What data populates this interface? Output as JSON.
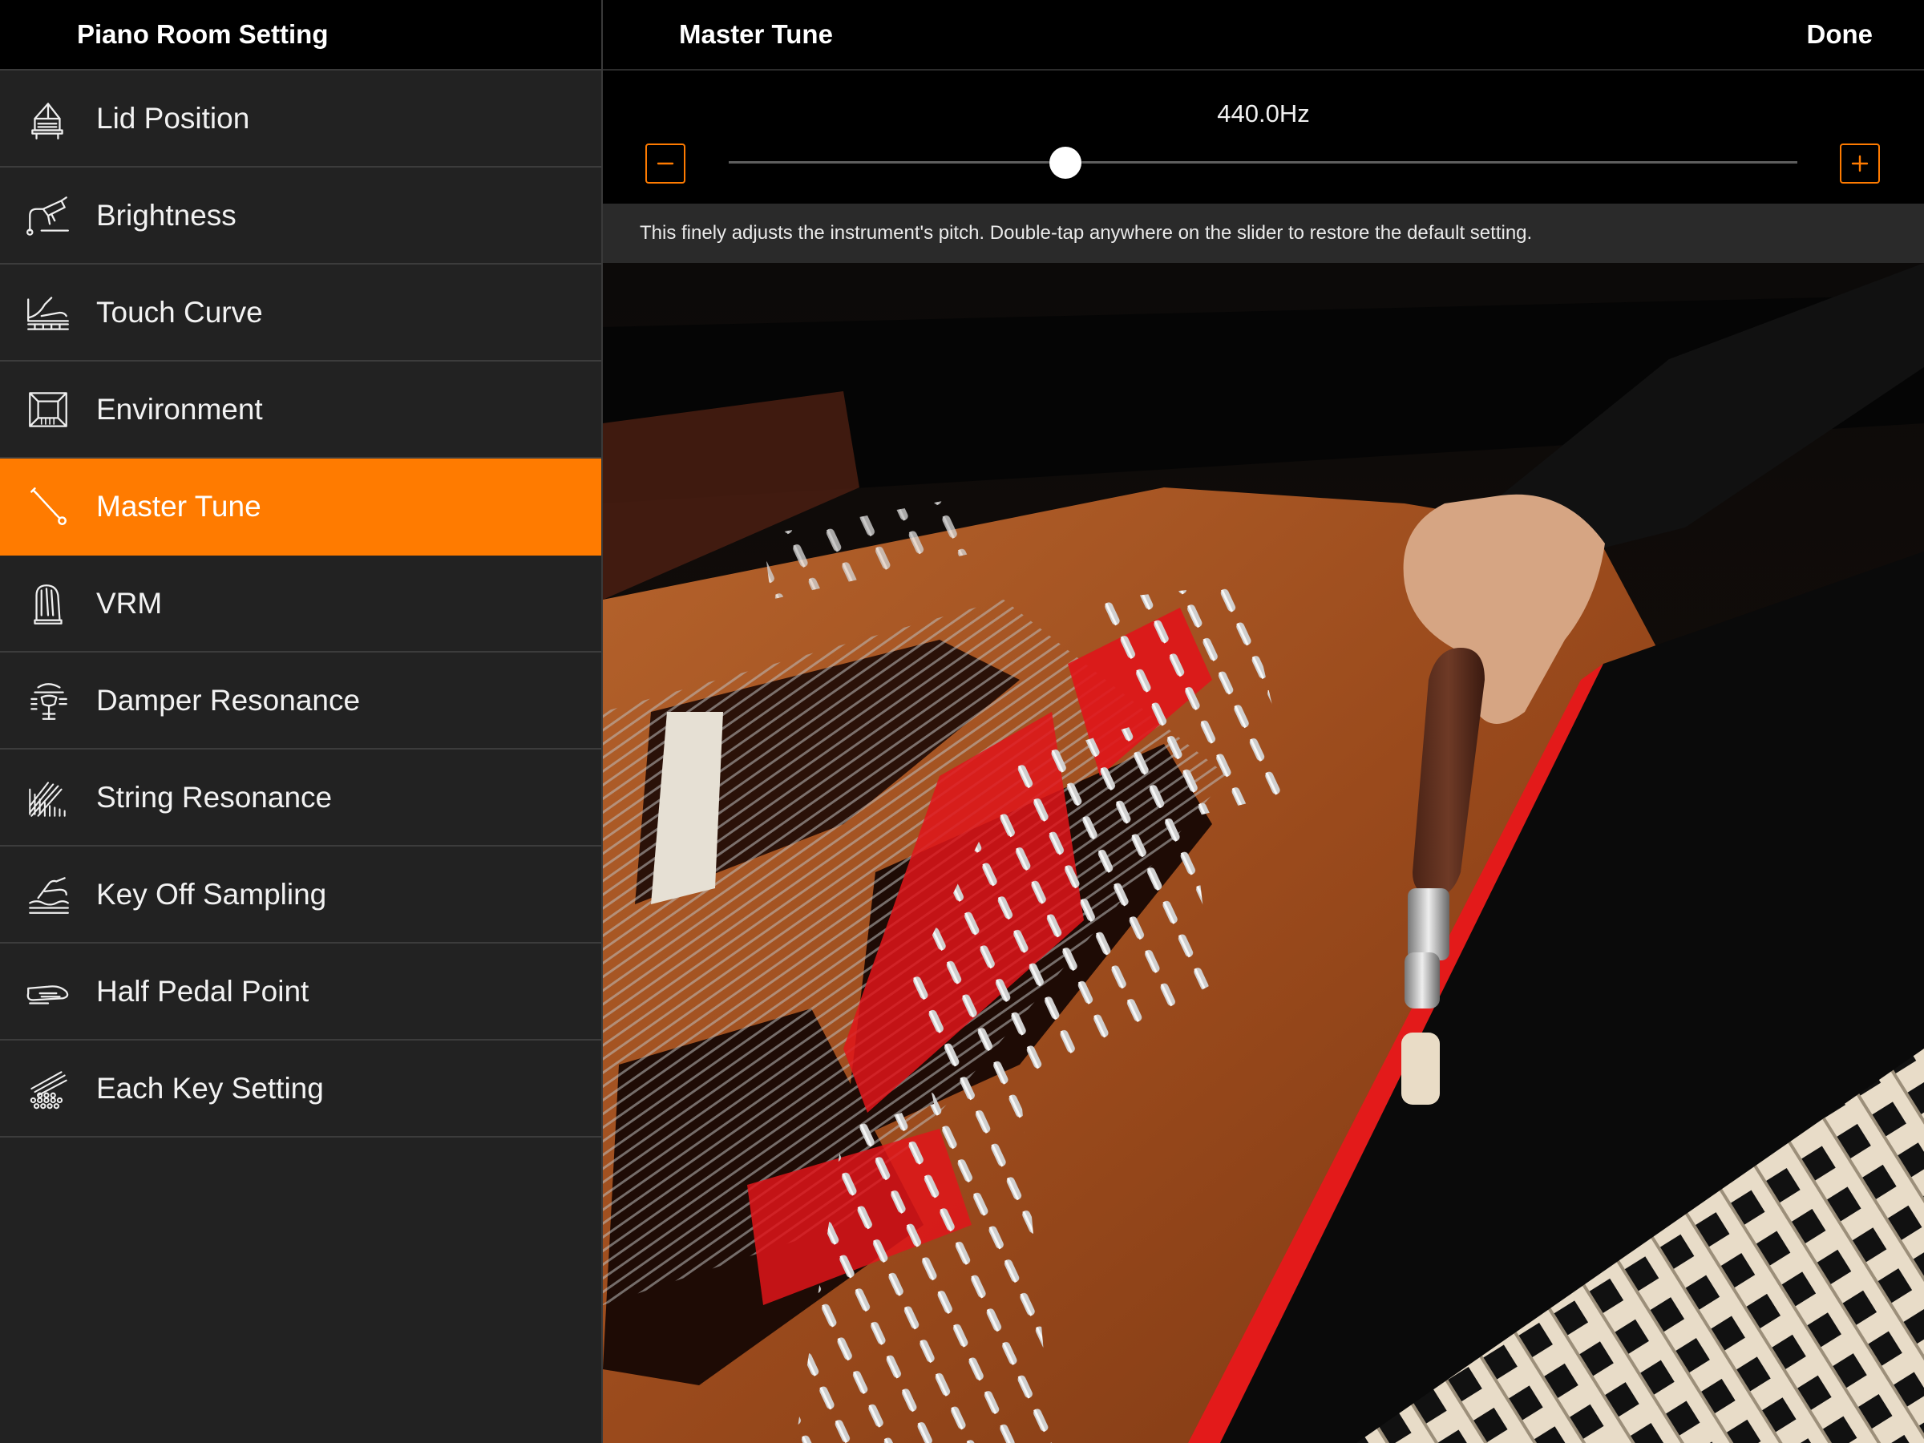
{
  "left_panel": {
    "title": "Piano Room Setting",
    "items": [
      {
        "label": "Lid Position",
        "icon": "grand-piano-lid-icon",
        "active": false
      },
      {
        "label": "Brightness",
        "icon": "brightness-lamp-icon",
        "active": false
      },
      {
        "label": "Touch Curve",
        "icon": "touch-curve-hand-icon",
        "active": false
      },
      {
        "label": "Environment",
        "icon": "room-environment-icon",
        "active": false
      },
      {
        "label": "Master Tune",
        "icon": "tuning-hammer-icon",
        "active": true
      },
      {
        "label": "VRM",
        "icon": "vrm-piano-icon",
        "active": false
      },
      {
        "label": "Damper Resonance",
        "icon": "damper-resonance-icon",
        "active": false
      },
      {
        "label": "String Resonance",
        "icon": "string-resonance-icon",
        "active": false
      },
      {
        "label": "Key Off Sampling",
        "icon": "key-off-hand-icon",
        "active": false
      },
      {
        "label": "Half Pedal Point",
        "icon": "pedal-foot-icon",
        "active": false
      },
      {
        "label": "Each Key Setting",
        "icon": "each-key-dots-icon",
        "active": false
      }
    ]
  },
  "detail": {
    "title": "Master Tune",
    "done_label": "Done",
    "value_label": "440.0Hz",
    "slider_fraction": 0.315,
    "hint": "This finely adjusts the instrument's pitch. Double-tap anywhere on the slider to restore the default setting.",
    "minus_icon": "minus-icon",
    "plus_icon": "plus-icon"
  },
  "colors": {
    "accent": "#ff7b00",
    "sidebar_bg": "#222222",
    "header_bg": "#000000",
    "hint_bg": "#2a2a2a"
  }
}
